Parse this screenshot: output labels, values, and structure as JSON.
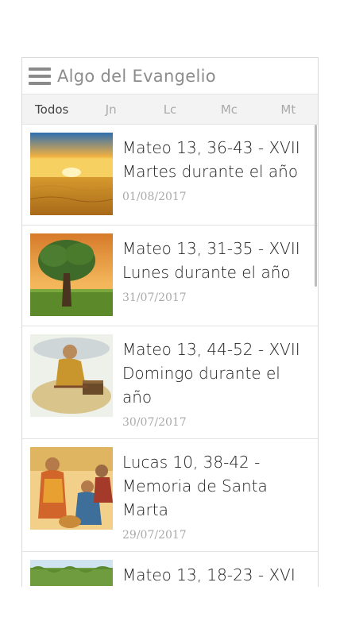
{
  "header": {
    "title": "Algo del Evangelio"
  },
  "tabs": [
    {
      "label": "Todos",
      "active": true
    },
    {
      "label": "Jn",
      "active": false
    },
    {
      "label": "Lc",
      "active": false
    },
    {
      "label": "Mc",
      "active": false
    },
    {
      "label": "Mt",
      "active": false
    }
  ],
  "items": [
    {
      "title": "Mateo 13, 36-43 - XVII Martes durante el año",
      "date": "01/08/2017",
      "image": "sunset-wheat-field"
    },
    {
      "title": "Mateo 13, 31-35 - XVII Lunes durante el año",
      "date": "31/07/2017",
      "image": "tree-at-sunset"
    },
    {
      "title": "Mateo 13, 44-52 - XVII Domingo durante el año",
      "date": "30/07/2017",
      "image": "man-digging-treasure"
    },
    {
      "title": "Lucas 10, 38-42 - Memoria de Santa Marta",
      "date": "29/07/2017",
      "image": "martha-and-mary"
    },
    {
      "title": "Mateo 13, 18-23 - XVI",
      "date": "",
      "image": "green-field"
    }
  ],
  "colors": {
    "title_gray": "#8c8c8c",
    "date_gray": "#aaaaaa",
    "tab_bar": "#f3f3f3"
  }
}
